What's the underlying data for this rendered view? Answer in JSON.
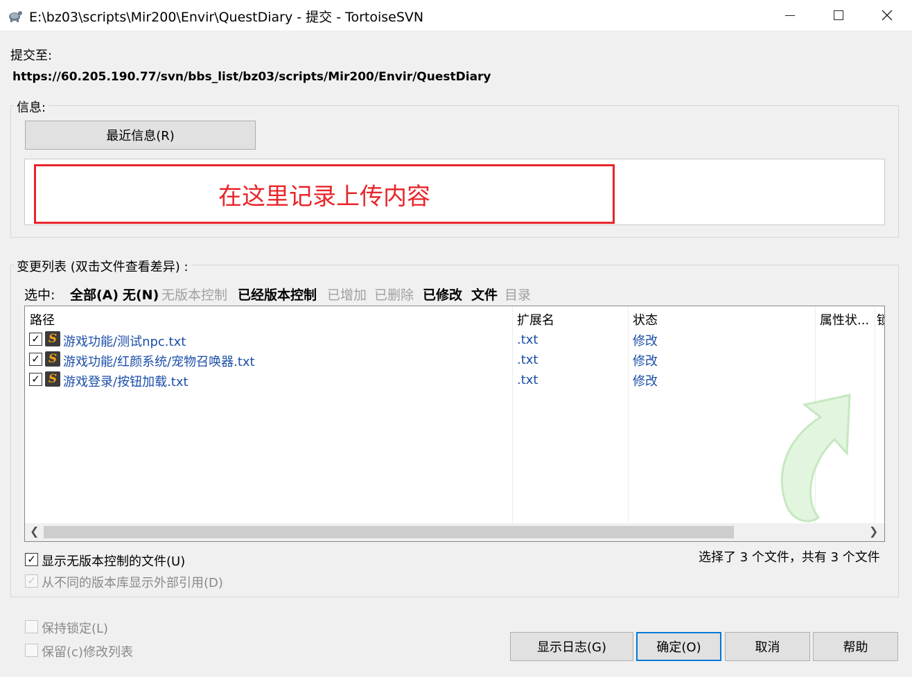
{
  "window": {
    "title": "E:\\bz03\\scripts\\Mir200\\Envir\\QuestDiary - 提交 - TortoiseSVN",
    "minimize": "–",
    "maximize": "□",
    "close": "✕"
  },
  "commit": {
    "to_label": "提交至:",
    "url": "https://60.205.190.77/svn/bbs_list/bz03/scripts/Mir200/Envir/QuestDiary"
  },
  "message": {
    "group_label": "信息:",
    "recent_button": "最近信息(R)",
    "annotation": "在这里记录上传内容"
  },
  "changes": {
    "group_label": "变更列表 (双击文件查看差异) :",
    "select_label": "选中:",
    "filters": [
      {
        "label": "全部(A)",
        "active": true
      },
      {
        "label": "无(N)",
        "active": true
      },
      {
        "label": "无版本控制",
        "active": false
      },
      {
        "label": "已经版本控制",
        "active": true
      },
      {
        "label": "已增加",
        "active": false
      },
      {
        "label": "已删除",
        "active": false
      },
      {
        "label": "已修改",
        "active": true
      },
      {
        "label": "文件",
        "active": true
      },
      {
        "label": "目录",
        "active": false
      }
    ],
    "columns": [
      "路径",
      "扩展名",
      "状态",
      "属性状...",
      "锁"
    ],
    "rows": [
      {
        "path": "游戏功能/测试npc.txt",
        "ext": ".txt",
        "status": "修改"
      },
      {
        "path": "游戏功能/红颜系统/宠物召唤器.txt",
        "ext": ".txt",
        "status": "修改"
      },
      {
        "path": "游戏登录/按钮加载.txt",
        "ext": ".txt",
        "status": "修改"
      }
    ],
    "show_unversioned": "显示无版本控制的文件(U)",
    "show_externals": "从不同的版本库显示外部引用(D)",
    "summary": "选择了 3 个文件，共有 3 个文件"
  },
  "options": {
    "keep_locks": "保持锁定(L)",
    "keep_changelists": "保留(c)修改列表"
  },
  "buttons": {
    "show_log": "显示日志(G)",
    "ok": "确定(O)",
    "cancel": "取消",
    "help": "帮助"
  },
  "colors": {
    "accent": "#0078d7",
    "annotation_red": "#e8252a",
    "link_blue": "#1a4ea8"
  }
}
